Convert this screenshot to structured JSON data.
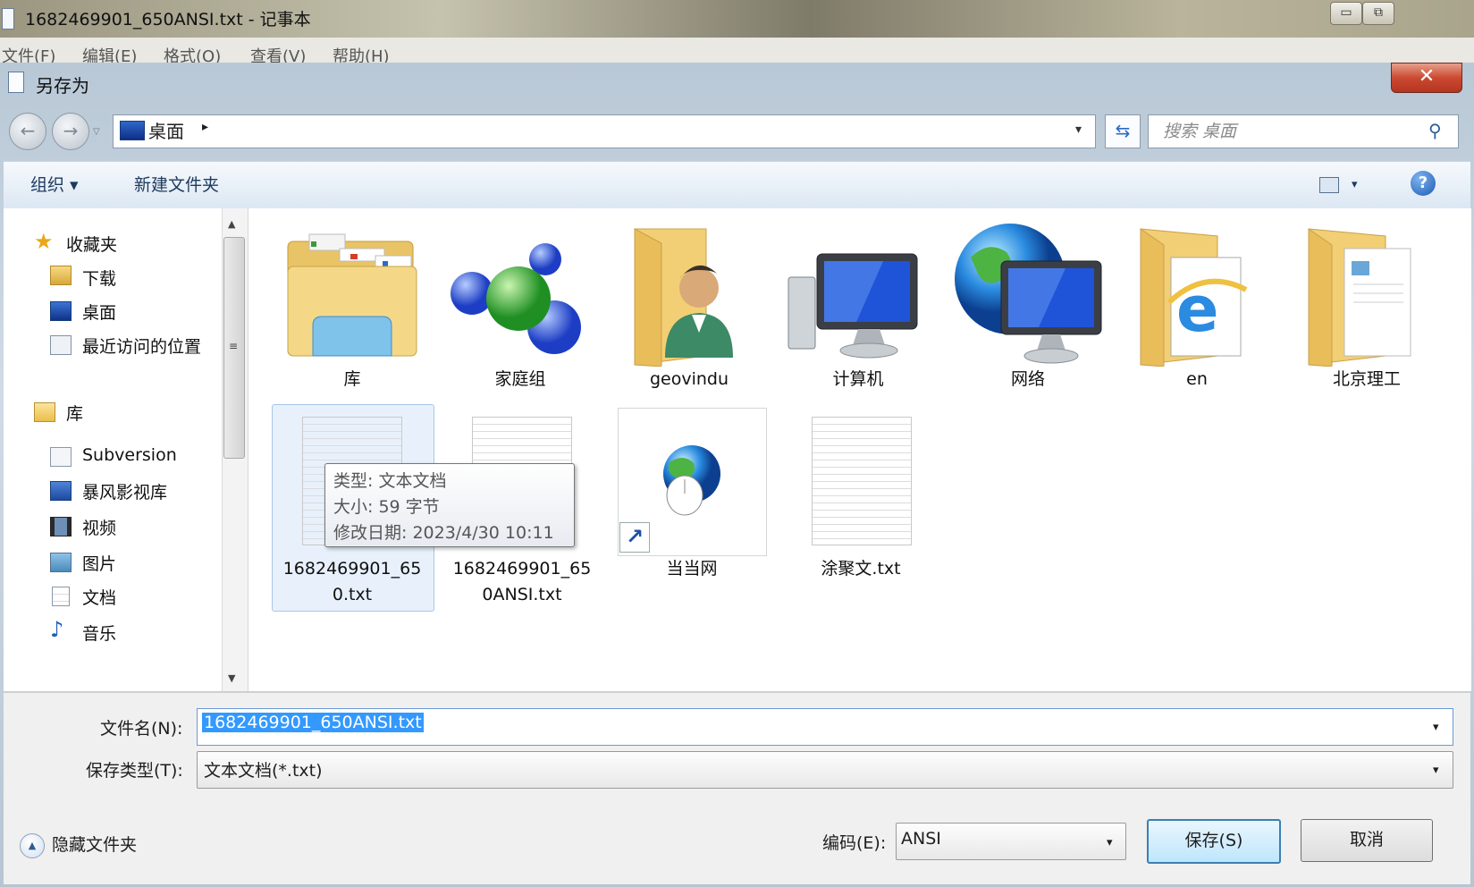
{
  "notepad": {
    "title": "1682469901_650ANSI.txt - 记事本",
    "menu": [
      "文件(F)",
      "编辑(E)",
      "格式(O)",
      "查看(V)",
      "帮助(H)"
    ],
    "minimize_glyph": "▭",
    "maximize_glyph": "⧉"
  },
  "dialog": {
    "title": "另存为",
    "close_glyph": "✕"
  },
  "nav": {
    "back_glyph": "←",
    "forward_glyph": "→",
    "history_glyph": "▽",
    "address": "桌面",
    "address_arrow": "▸",
    "address_dropdown": "▾",
    "refresh_glyph": "⇆",
    "search_placeholder": "搜索 桌面",
    "search_glyph": "⚲"
  },
  "toolbar": {
    "organize": "组织 ▾",
    "new_folder": "新建文件夹",
    "view_dropdown": "▾",
    "help": "?"
  },
  "sidebar": {
    "favorites_header": "收藏夹",
    "favorites": [
      "下载",
      "桌面",
      "最近访问的位置"
    ],
    "libraries_header": "库",
    "libraries": [
      "Subversion",
      "暴风影视库",
      "视频",
      "图片",
      "文档",
      "音乐"
    ],
    "scroll_up": "▲",
    "scroll_down": "▼",
    "grip": "≡"
  },
  "files": {
    "row1": [
      "库",
      "家庭组",
      "geovindu",
      "计算机",
      "网络",
      "en",
      "北京理工"
    ],
    "row2": [
      {
        "line1": "1682469901_65",
        "line2": "0.txt"
      },
      {
        "line1": "1682469901_65",
        "line2": "0ANSI.txt"
      },
      {
        "line1": "当当网",
        "line2": ""
      },
      {
        "line1": "涂聚文.txt",
        "line2": ""
      }
    ],
    "shortcut_arrow": "↗"
  },
  "tooltip": {
    "type": "类型: 文本文档",
    "size": "大小: 59 字节",
    "modified": "修改日期: 2023/4/30 10:11"
  },
  "form": {
    "filename_label": "文件名(N):",
    "filename_value": "1682469901_650ANSI.txt",
    "filetype_label": "保存类型(T):",
    "filetype_value": "文本文档(*.txt)",
    "dropdown": "▾",
    "hide_folders": "隐藏文件夹",
    "hide_glyph": "▲",
    "encoding_label": "编码(E):",
    "encoding_value": "ANSI",
    "save": "保存(S)",
    "cancel": "取消"
  },
  "colors": {
    "selection": "#3399ff",
    "folder": "#f2d27a",
    "close_red": "#cc4a32"
  }
}
